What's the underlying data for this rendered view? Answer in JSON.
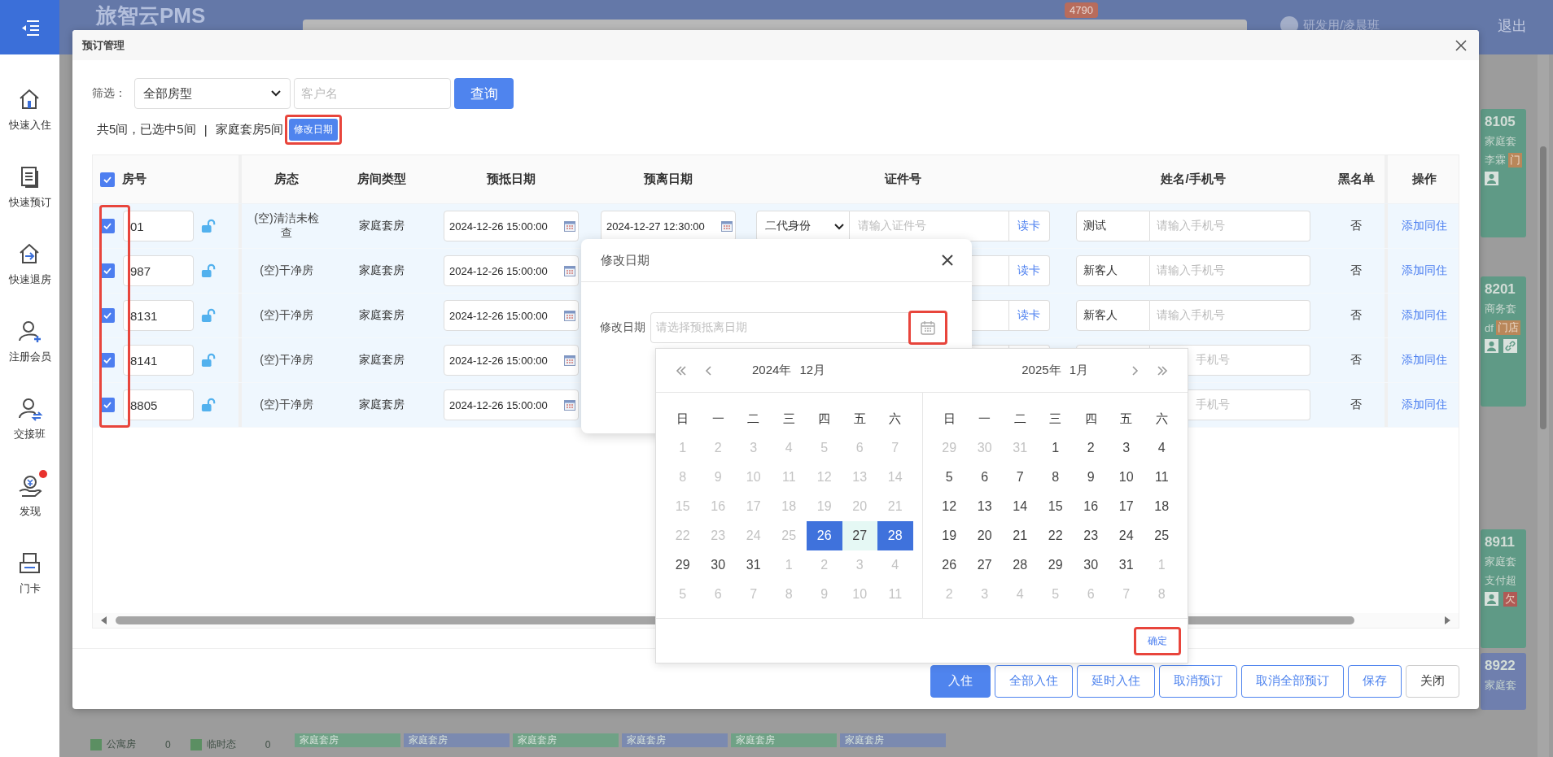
{
  "app": {
    "title": "旅智云PMS",
    "badge": "4790",
    "user": "研发用/凌晨班",
    "logout": "退出"
  },
  "sidebar": {
    "items": [
      {
        "label": "快速入住",
        "kind": "home",
        "alert": false
      },
      {
        "label": "快速预订",
        "kind": "list",
        "alert": false
      },
      {
        "label": "快速退房",
        "kind": "checkout",
        "alert": false
      },
      {
        "label": "注册会员",
        "kind": "user-add",
        "alert": false
      },
      {
        "label": "交接班",
        "kind": "user-swap",
        "alert": false
      },
      {
        "label": "发现",
        "kind": "coin-hand",
        "alert": true
      },
      {
        "label": "门卡",
        "kind": "card",
        "alert": false
      }
    ]
  },
  "room_cards": [
    {
      "number": "8105",
      "type": "家庭套",
      "guest": "李霖",
      "color": "#5f9a86",
      "tag": {
        "label": "门",
        "color": "#b9875a"
      },
      "icons": [
        {
          "kind": "person"
        }
      ]
    },
    {
      "number": "8201",
      "type": "商务套",
      "guest": "df",
      "color": "#5f9a86",
      "tag": {
        "label": "门店",
        "color": "#b9875a"
      },
      "icons": [
        {
          "kind": "person"
        },
        {
          "kind": "link"
        }
      ]
    },
    {
      "number": "8911",
      "type": "家庭套",
      "guest": "支付超",
      "color": "#5f9a86",
      "icons": [
        {
          "kind": "person"
        },
        {
          "kind": "tag",
          "label": "欠",
          "color": "#b05a55"
        }
      ]
    },
    {
      "number": "8922",
      "type": "家庭套",
      "color": "#6f7fae"
    }
  ],
  "legend": [
    {
      "label": "公寓房",
      "count": "0",
      "color": "#5b8f62"
    },
    {
      "label": "临时态",
      "count": "0",
      "color": "#5b8f62"
    }
  ],
  "strip": [
    {
      "label": "家庭套房",
      "color": "#6fa286"
    },
    {
      "label": "家庭套房",
      "color": "#7b8ab0"
    },
    {
      "label": "家庭套房",
      "color": "#6fa286"
    },
    {
      "label": "家庭套房",
      "color": "#7b8ab0"
    },
    {
      "label": "家庭套房",
      "color": "#6fa286"
    },
    {
      "label": "家庭套房",
      "color": "#7b8ab0"
    }
  ],
  "modal": {
    "title": "预订管理",
    "filter_label": "筛选：",
    "room_type": "全部房型",
    "customer_placeholder": "客户名",
    "query": "查询",
    "summary": "共5间，已选中5间",
    "separator": "|",
    "type_count": "家庭套房5间",
    "edit_date": {
      "label": "修改日期",
      "highlight": true
    },
    "all_checked": true,
    "checkbox_column_highlight": true,
    "columns": [
      "房号",
      "房态",
      "房间类型",
      "预抵日期",
      "预离日期",
      "证件号",
      "姓名/手机号",
      "黑名单",
      "操作"
    ],
    "rows": [
      {
        "checked": true,
        "room": "01",
        "locked": false,
        "status": "(空)清洁未检查",
        "room_type": "家庭套房",
        "arrival": "2024-12-26 15:00:00",
        "departure": "2024-12-27 12:30:00",
        "id_type": "二代身份",
        "id_placeholder": "请输入证件号",
        "read_card": "读卡",
        "name": "测试",
        "phone_placeholder": "请输入手机号",
        "blacklist": "否",
        "action": "添加同住"
      },
      {
        "checked": true,
        "room": "987",
        "locked": false,
        "status": "(空)干净房",
        "room_type": "家庭套房",
        "arrival": "2024-12-26 15:00:00",
        "read_card": "读卡",
        "name": "新客人",
        "phone_placeholder": "请输入手机号",
        "blacklist": "否",
        "action": "添加同住"
      },
      {
        "checked": true,
        "room": "8131",
        "locked": false,
        "status": "(空)干净房",
        "room_type": "家庭套房",
        "arrival": "2024-12-26 15:00:00",
        "read_card": "读卡",
        "name": "新客人",
        "phone_placeholder": "请输入手机号",
        "blacklist": "否",
        "action": "添加同住"
      },
      {
        "checked": true,
        "room": "8141",
        "locked": false,
        "status": "(空)干净房",
        "room_type": "家庭套房",
        "arrival": "2024-12-26 15:00:00",
        "phone_placeholder": "手机号",
        "blacklist": "否",
        "action": "添加同住"
      },
      {
        "checked": true,
        "room": "8805",
        "locked": false,
        "status": "(空)干净房",
        "room_type": "家庭套房",
        "arrival": "2024-12-26 15:00:00",
        "phone_placeholder": "手机号",
        "blacklist": "否",
        "action": "添加同住"
      }
    ],
    "buttons": [
      {
        "label": "入住",
        "kind": "primary"
      },
      {
        "label": "全部入住",
        "kind": "outline"
      },
      {
        "label": "延时入住",
        "kind": "outline"
      },
      {
        "label": "取消预订",
        "kind": "outline"
      },
      {
        "label": "取消全部预订",
        "kind": "outline"
      },
      {
        "label": "保存",
        "kind": "outline"
      },
      {
        "label": "关闭",
        "kind": "default"
      }
    ]
  },
  "dialog": {
    "title": "修改日期",
    "label": "修改日期",
    "placeholder": "请选择预抵离日期",
    "icon_highlight": true
  },
  "calendar": {
    "confirm": {
      "label": "确定",
      "highlight": true
    },
    "panels": [
      {
        "year": "2024年",
        "month": "12月",
        "weekdays": [
          "日",
          "一",
          "二",
          "三",
          "四",
          "五",
          "六"
        ],
        "weeks": [
          [
            {
              "day": "1",
              "kind": "muted"
            },
            {
              "day": "2",
              "kind": "muted"
            },
            {
              "day": "3",
              "kind": "muted"
            },
            {
              "day": "4",
              "kind": "muted"
            },
            {
              "day": "5",
              "kind": "muted"
            },
            {
              "day": "6",
              "kind": "muted"
            },
            {
              "day": "7",
              "kind": "muted"
            }
          ],
          [
            {
              "day": "8",
              "kind": "muted"
            },
            {
              "day": "9",
              "kind": "muted"
            },
            {
              "day": "10",
              "kind": "muted"
            },
            {
              "day": "11",
              "kind": "muted"
            },
            {
              "day": "12",
              "kind": "muted"
            },
            {
              "day": "13",
              "kind": "muted"
            },
            {
              "day": "14",
              "kind": "muted"
            }
          ],
          [
            {
              "day": "15",
              "kind": "muted"
            },
            {
              "day": "16",
              "kind": "muted"
            },
            {
              "day": "17",
              "kind": "muted"
            },
            {
              "day": "18",
              "kind": "muted"
            },
            {
              "day": "19",
              "kind": "muted"
            },
            {
              "day": "20",
              "kind": "muted"
            },
            {
              "day": "21",
              "kind": "muted"
            }
          ],
          [
            {
              "day": "22",
              "kind": "muted"
            },
            {
              "day": "23",
              "kind": "muted"
            },
            {
              "day": "24",
              "kind": "muted"
            },
            {
              "day": "25",
              "kind": "muted"
            },
            {
              "day": "26",
              "kind": "start"
            },
            {
              "day": "27",
              "kind": "range"
            },
            {
              "day": "28",
              "kind": "end"
            }
          ],
          [
            {
              "day": "29",
              "kind": "normal"
            },
            {
              "day": "30",
              "kind": "normal"
            },
            {
              "day": "31",
              "kind": "normal"
            },
            {
              "day": "1",
              "kind": "muted"
            },
            {
              "day": "2",
              "kind": "muted"
            },
            {
              "day": "3",
              "kind": "muted"
            },
            {
              "day": "4",
              "kind": "muted"
            }
          ],
          [
            {
              "day": "5",
              "kind": "muted"
            },
            {
              "day": "6",
              "kind": "muted"
            },
            {
              "day": "7",
              "kind": "muted"
            },
            {
              "day": "8",
              "kind": "muted"
            },
            {
              "day": "9",
              "kind": "muted"
            },
            {
              "day": "10",
              "kind": "muted"
            },
            {
              "day": "11",
              "kind": "muted"
            }
          ]
        ]
      },
      {
        "year": "2025年",
        "month": "1月",
        "weekdays": [
          "日",
          "一",
          "二",
          "三",
          "四",
          "五",
          "六"
        ],
        "weeks": [
          [
            {
              "day": "29",
              "kind": "muted"
            },
            {
              "day": "30",
              "kind": "muted"
            },
            {
              "day": "31",
              "kind": "muted"
            },
            {
              "day": "1",
              "kind": "normal"
            },
            {
              "day": "2",
              "kind": "normal"
            },
            {
              "day": "3",
              "kind": "normal"
            },
            {
              "day": "4",
              "kind": "normal"
            }
          ],
          [
            {
              "day": "5",
              "kind": "normal"
            },
            {
              "day": "6",
              "kind": "normal"
            },
            {
              "day": "7",
              "kind": "normal"
            },
            {
              "day": "8",
              "kind": "normal"
            },
            {
              "day": "9",
              "kind": "normal"
            },
            {
              "day": "10",
              "kind": "normal"
            },
            {
              "day": "11",
              "kind": "normal"
            }
          ],
          [
            {
              "day": "12",
              "kind": "normal"
            },
            {
              "day": "13",
              "kind": "normal"
            },
            {
              "day": "14",
              "kind": "normal"
            },
            {
              "day": "15",
              "kind": "normal"
            },
            {
              "day": "16",
              "kind": "normal"
            },
            {
              "day": "17",
              "kind": "normal"
            },
            {
              "day": "18",
              "kind": "normal"
            }
          ],
          [
            {
              "day": "19",
              "kind": "normal"
            },
            {
              "day": "20",
              "kind": "normal"
            },
            {
              "day": "21",
              "kind": "normal"
            },
            {
              "day": "22",
              "kind": "normal"
            },
            {
              "day": "23",
              "kind": "normal"
            },
            {
              "day": "24",
              "kind": "normal"
            },
            {
              "day": "25",
              "kind": "normal"
            }
          ],
          [
            {
              "day": "26",
              "kind": "normal"
            },
            {
              "day": "27",
              "kind": "normal"
            },
            {
              "day": "28",
              "kind": "normal"
            },
            {
              "day": "29",
              "kind": "normal"
            },
            {
              "day": "30",
              "kind": "normal"
            },
            {
              "day": "31",
              "kind": "normal"
            },
            {
              "day": "1",
              "kind": "muted"
            }
          ],
          [
            {
              "day": "2",
              "kind": "muted"
            },
            {
              "day": "3",
              "kind": "muted"
            },
            {
              "day": "4",
              "kind": "muted"
            },
            {
              "day": "5",
              "kind": "muted"
            },
            {
              "day": "6",
              "kind": "muted"
            },
            {
              "day": "7",
              "kind": "muted"
            },
            {
              "day": "8",
              "kind": "muted"
            }
          ]
        ]
      }
    ]
  }
}
